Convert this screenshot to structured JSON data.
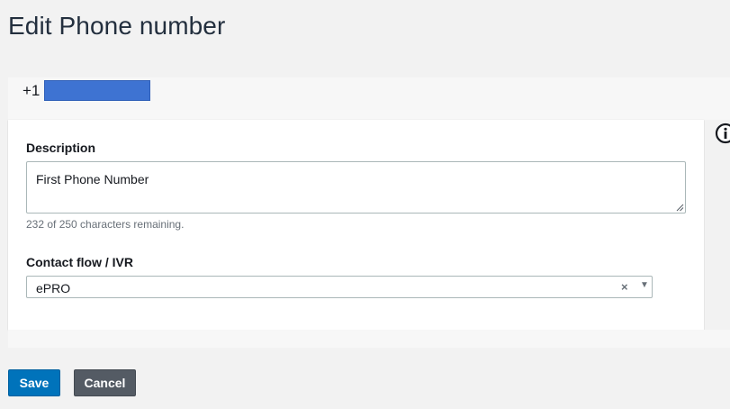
{
  "page": {
    "title": "Edit Phone number"
  },
  "phone": {
    "prefix": "+1"
  },
  "form": {
    "description": {
      "label": "Description",
      "value": "First Phone Number",
      "helper": "232 of 250 characters remaining."
    },
    "contact_flow": {
      "label": "Contact flow / IVR",
      "selected": "ePRO",
      "clear_glyph": "×",
      "caret_glyph": "▼"
    }
  },
  "actions": {
    "save_label": "Save",
    "cancel_label": "Cancel"
  },
  "colors": {
    "primary": "#0073bb",
    "secondary": "#545b64",
    "redaction": "#3e73d2"
  },
  "icons": {
    "info": "info-icon"
  }
}
